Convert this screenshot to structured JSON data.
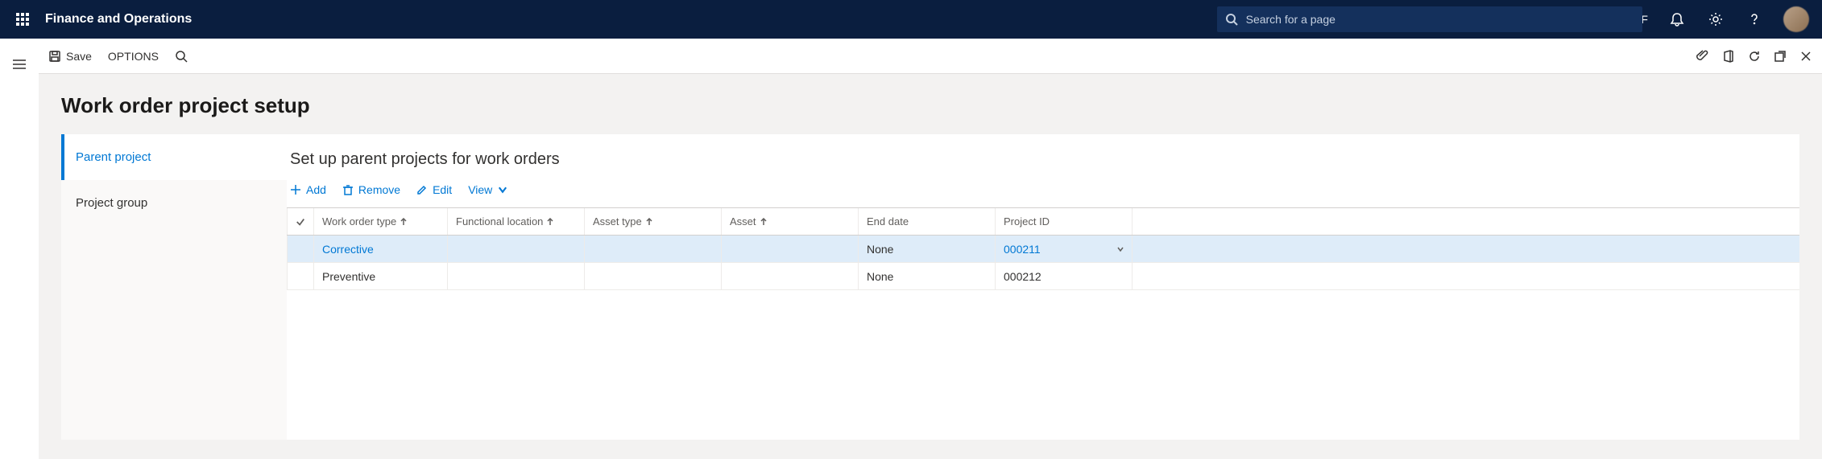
{
  "header": {
    "app_title": "Finance and Operations",
    "search_placeholder": "Search for a page",
    "company": "USMF"
  },
  "actionbar": {
    "save_label": "Save",
    "options_label": "OPTIONS"
  },
  "page": {
    "title": "Work order project setup"
  },
  "side_tabs": {
    "parent_project": "Parent project",
    "project_group": "Project group"
  },
  "panel": {
    "title": "Set up parent projects for work orders",
    "toolbar": {
      "add": "Add",
      "remove": "Remove",
      "edit": "Edit",
      "view": "View"
    }
  },
  "grid": {
    "columns": {
      "work_order_type": "Work order type",
      "functional_location": "Functional location",
      "asset_type": "Asset type",
      "asset": "Asset",
      "end_date": "End date",
      "project_id": "Project ID"
    },
    "rows": [
      {
        "work_order_type": "Corrective",
        "functional_location": "",
        "asset_type": "",
        "asset": "",
        "end_date": "None",
        "project_id": "000211",
        "selected": true
      },
      {
        "work_order_type": "Preventive",
        "functional_location": "",
        "asset_type": "",
        "asset": "",
        "end_date": "None",
        "project_id": "000212",
        "selected": false
      }
    ]
  }
}
